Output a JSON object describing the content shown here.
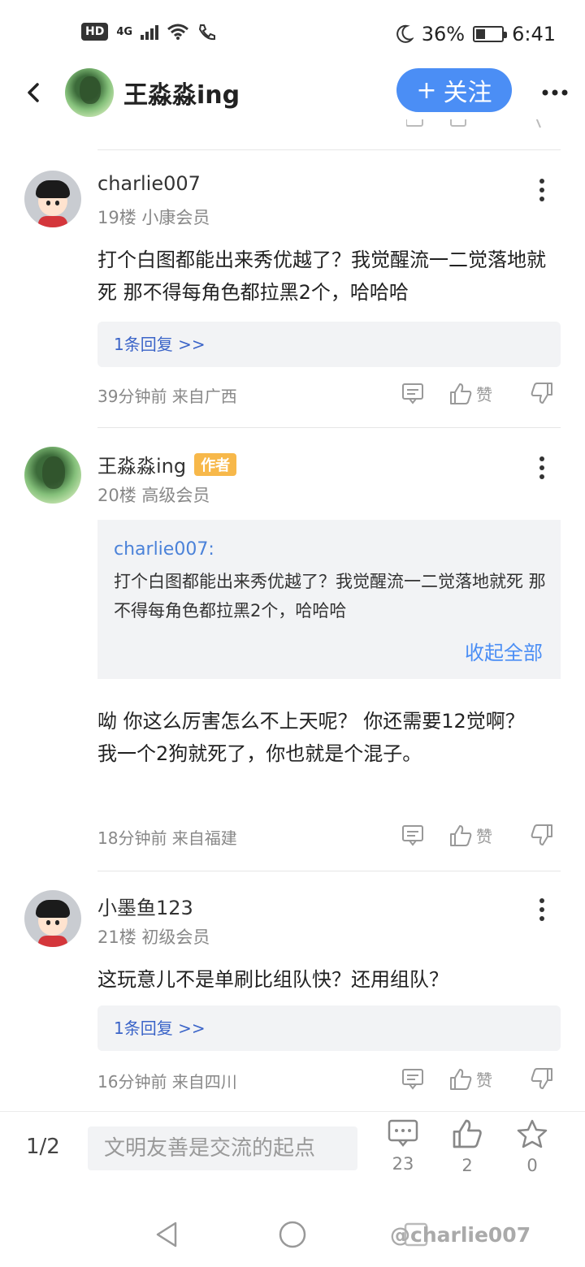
{
  "status_bar": {
    "hd": "HD",
    "network": "4G",
    "battery_pct": "36%",
    "battery_level": 0.36,
    "time": "6:41"
  },
  "header": {
    "title": "王淼淼ing",
    "follow_label": "关注"
  },
  "comments": [
    {
      "user": "charlie007",
      "floor_level": "19楼 小康会员",
      "text": "打个白图都能出来秀优越了？我觉醒流一二觉落地就死  那不得每角色都拉黑2个，哈哈哈",
      "reply_link": "1条回复 >>",
      "time_loc": "39分钟前 来自广西",
      "like_label": "赞"
    },
    {
      "user": "王淼淼ing",
      "badge": "作者",
      "floor_level": "20楼 高级会员",
      "quote_user": "charlie007:",
      "quote_text": "打个白图都能出来秀优越了？我觉醒流一二觉落地就死  那不得每角色都拉黑2个，哈哈哈",
      "collapse_label": "收起全部",
      "text": "呦  你这么厉害怎么不上天呢？   你还需要12觉啊？\n我一个2狗就死了，你也就是个混子。",
      "time_loc": "18分钟前 来自福建",
      "like_label": "赞"
    },
    {
      "user": "小墨鱼123",
      "floor_level": "21楼 初级会员",
      "text": "这玩意儿不是单刷比组队快？还用组队？",
      "reply_link": "1条回复 >>",
      "time_loc": "16分钟前 来自四川",
      "like_label": "赞"
    }
  ],
  "bottom_bar": {
    "page": "1/2",
    "input_placeholder": "文明友善是交流的起点",
    "comment_count": "23",
    "like_count": "2",
    "fav_count": "0"
  },
  "watermark": "@charlie007",
  "colors": {
    "accent": "#4b8ef5",
    "author_badge": "#f7b84a",
    "link": "#3b64c8"
  }
}
